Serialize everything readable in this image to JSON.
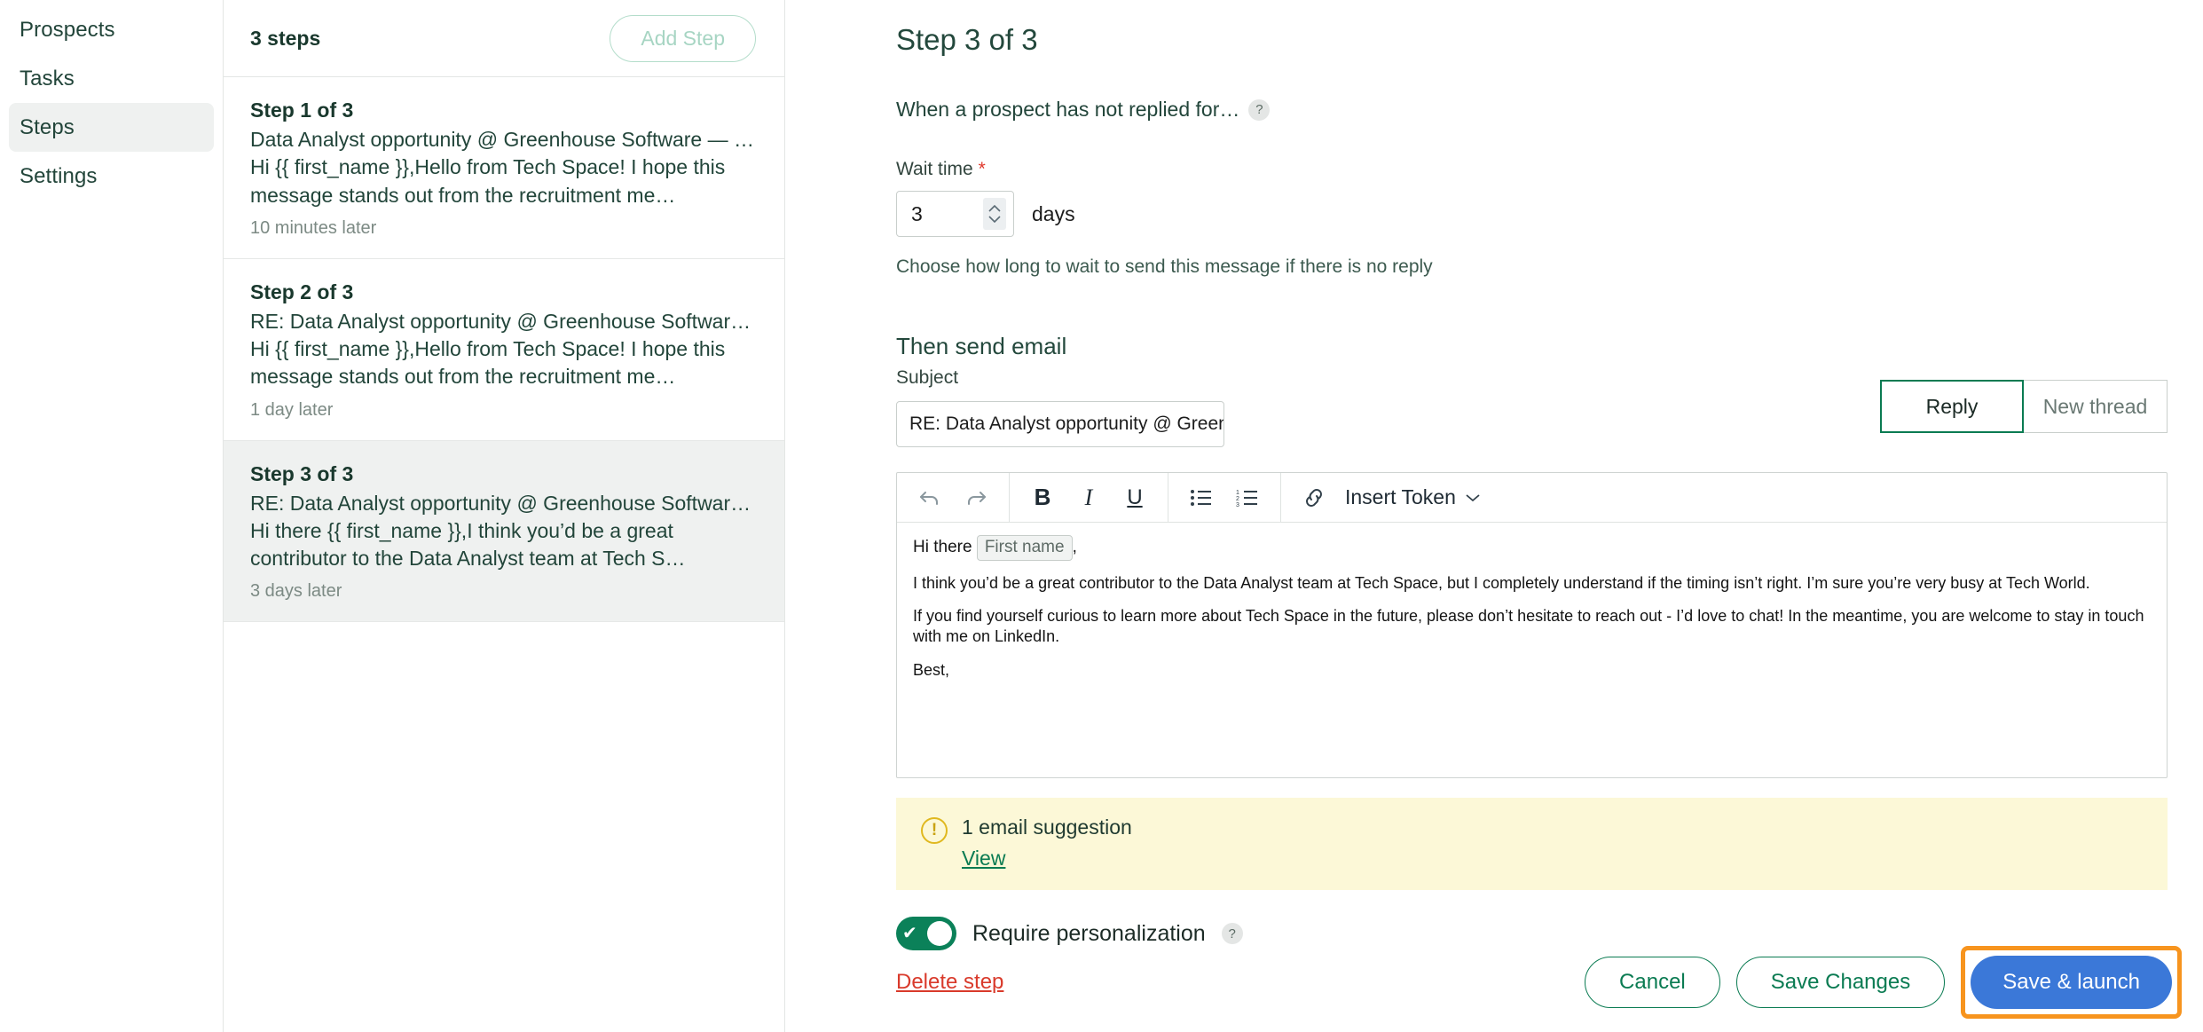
{
  "sidebar": {
    "items": [
      {
        "label": "Prospects",
        "active": false
      },
      {
        "label": "Tasks",
        "active": false
      },
      {
        "label": "Steps",
        "active": true
      },
      {
        "label": "Settings",
        "active": false
      }
    ]
  },
  "steps_panel": {
    "count_label": "3 steps",
    "add_step_label": "Add Step",
    "steps": [
      {
        "title": "Step 1 of 3",
        "subject": "Data Analyst opportunity @ Greenhouse Software — le…",
        "preview_line1": "Hi {{ first_name }},Hello from Tech Space! I hope this",
        "preview_line2": "message stands out from the recruitment me…",
        "timing": "10 minutes later",
        "selected": false
      },
      {
        "title": "Step 2 of 3",
        "subject": "RE: Data Analyst opportunity @ Greenhouse Software …",
        "preview_line1": "Hi {{ first_name }},Hello from Tech Space! I hope this",
        "preview_line2": "message stands out from the recruitment me…",
        "timing": "1 day later",
        "selected": false
      },
      {
        "title": "Step 3 of 3",
        "subject": "RE: Data Analyst opportunity @ Greenhouse Software …",
        "preview_line1": "Hi there {{ first_name }},I think you’d be a great",
        "preview_line2": "contributor to the Data Analyst team at Tech S…",
        "timing": "3 days later",
        "selected": true
      }
    ]
  },
  "editor_panel": {
    "page_title": "Step 3 of 3",
    "condition_label": "When a prospect has not replied for…",
    "help_glyph": "?",
    "wait_time_label": "Wait time",
    "required_marker": "*",
    "wait_value": "3",
    "wait_unit": "days",
    "wait_helper": "Choose how long to wait to send this message if there is no reply",
    "then_send_email": "Then send email",
    "subject_label": "Subject",
    "subject_value": "RE: Data Analyst opportunity @ Greenh",
    "thread_mode": {
      "reply_label": "Reply",
      "new_thread_label": "New thread",
      "selected": "Reply"
    },
    "toolbar": {
      "undo": "undo-icon",
      "redo": "redo-icon",
      "bold": "B",
      "italic": "I",
      "underline": "U",
      "bullet_list": "bullet-list-icon",
      "numbered_list": "numbered-list-icon",
      "link": "link-icon",
      "insert_token_label": "Insert Token",
      "chevron": "⌄"
    },
    "body": {
      "greeting_prefix": "Hi there ",
      "token_chip": "First name",
      "greeting_suffix": ",",
      "paragraph1": "I think you’d be a great contributor to the Data Analyst team at Tech Space, but I completely understand if the timing isn’t right. I’m sure you’re very busy at Tech World.",
      "paragraph2": "If you find yourself curious to learn more about Tech Space in the future, please don’t hesitate to reach out - I’d love to chat! In the meantime, you are welcome to stay in touch with me on LinkedIn.",
      "paragraph3": "Best,"
    },
    "suggestion": {
      "icon": "warning-icon",
      "text": "1 email suggestion",
      "link": "View"
    },
    "personalization": {
      "label": "Require personalization",
      "enabled": true,
      "check_glyph": "✔",
      "help_glyph": "?"
    },
    "footer": {
      "delete_label": "Delete step",
      "cancel_label": "Cancel",
      "save_changes_label": "Save Changes",
      "save_launch_label": "Save & launch"
    }
  },
  "colors": {
    "accent_green": "#0a7b52",
    "primary_blue": "#3b78d8",
    "highlight_orange": "#f7941e",
    "danger_red": "#d93a2b",
    "warning_bg": "#fcf8d7"
  }
}
